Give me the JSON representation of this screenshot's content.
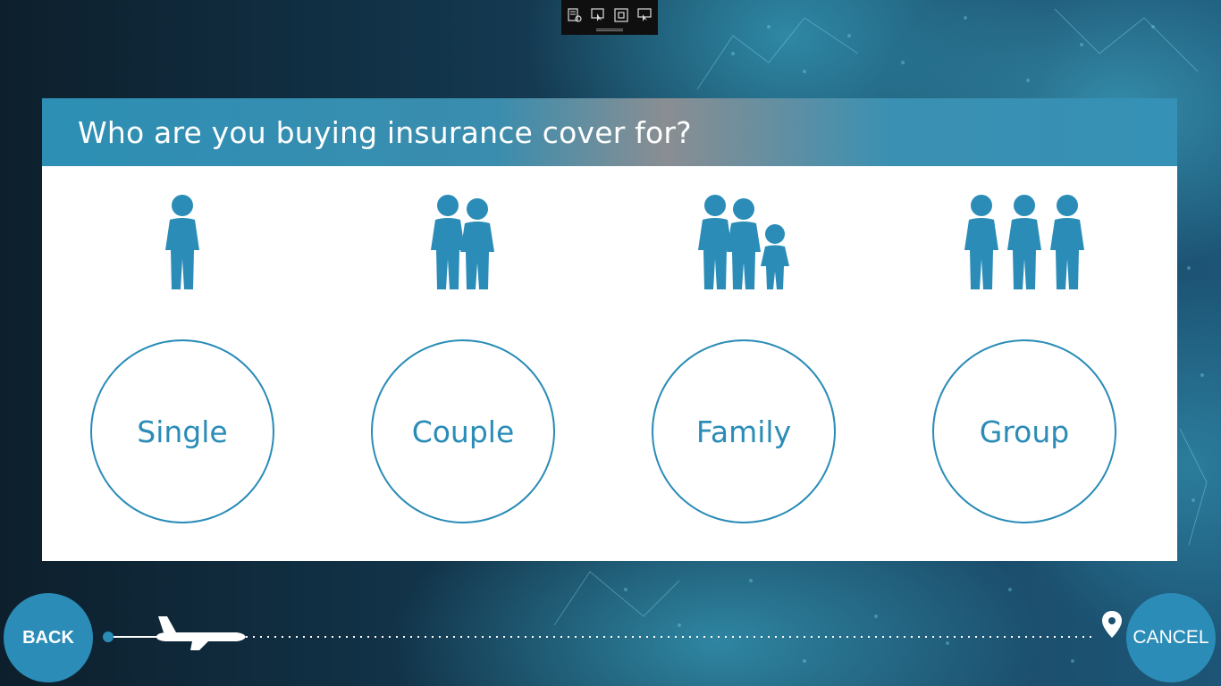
{
  "toolbar": {
    "icons": [
      "settings-page-icon",
      "pointer-select-icon",
      "frame-icon",
      "screen-pointer-icon"
    ]
  },
  "question": {
    "title": "Who are you buying insurance cover for?"
  },
  "options": [
    {
      "label": "Single",
      "icon": "single-person-icon"
    },
    {
      "label": "Couple",
      "icon": "couple-icon"
    },
    {
      "label": "Family",
      "icon": "family-icon"
    },
    {
      "label": "Group",
      "icon": "group-icon"
    }
  ],
  "nav": {
    "back_label": "BACK",
    "cancel_label": "CANCEL"
  },
  "colors": {
    "accent": "#2a8cb7",
    "header_bar": "#3591b6",
    "card_bg": "#ffffff"
  }
}
